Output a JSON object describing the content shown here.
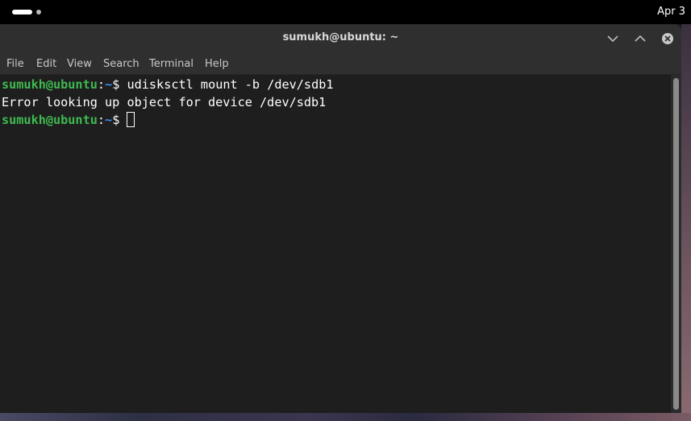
{
  "topbar": {
    "clock": "Apr 3"
  },
  "window": {
    "title": "sumukh@ubuntu: ~",
    "buttons": [
      "minimize",
      "maximize",
      "close"
    ]
  },
  "menubar": {
    "items": [
      "File",
      "Edit",
      "View",
      "Search",
      "Terminal",
      "Help"
    ]
  },
  "terminal": {
    "lines": [
      {
        "user": "sumukh@ubuntu",
        "sep": ":",
        "path": "~",
        "symbol": "$ ",
        "command": "udisksctl mount -b /dev/sdb1"
      },
      {
        "output": "Error looking up object for device /dev/sdb1"
      },
      {
        "user": "sumukh@ubuntu",
        "sep": ":",
        "path": "~",
        "symbol": "$ ",
        "command": ""
      }
    ]
  },
  "colors": {
    "prompt_user": "#3fb950",
    "prompt_path": "#3b8eea",
    "background": "#1e1e1e",
    "titlebar": "#2f2f2f"
  },
  "icons": {
    "minimize": "chevron-down-icon",
    "maximize": "chevron-up-icon",
    "close": "close-icon"
  }
}
